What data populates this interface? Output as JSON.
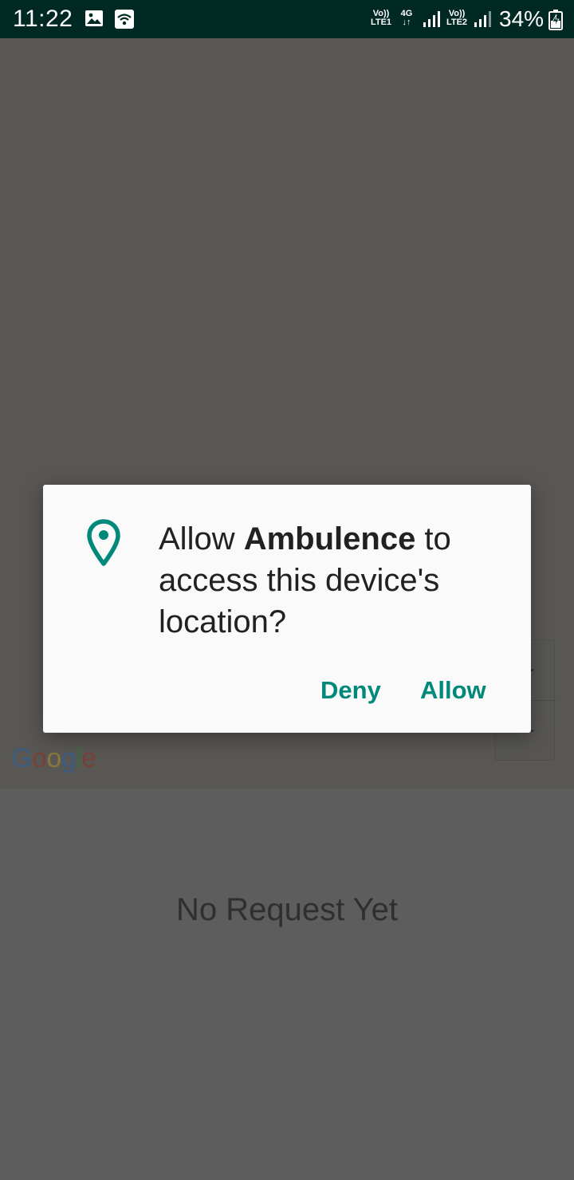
{
  "status_bar": {
    "time": "11:22",
    "sim1_top": "Vo))",
    "sim1_bottom": "LTE1",
    "network_top": "4G",
    "network_bottom": "↓↑",
    "sim2_top": "Vo))",
    "sim2_bottom": "LTE2",
    "battery": "34%"
  },
  "map": {
    "zoom_in_label": "+",
    "zoom_out_label": "−",
    "attribution": {
      "letters": [
        "G",
        "o",
        "o",
        "g",
        "l",
        "e"
      ]
    }
  },
  "panel": {
    "status_text": "No Request Yet"
  },
  "dialog": {
    "message_prefix": "Allow ",
    "app_name": "Ambulence",
    "message_suffix": " to access this device's location?",
    "deny_label": "Deny",
    "allow_label": "Allow",
    "accent_color": "#00897b"
  }
}
